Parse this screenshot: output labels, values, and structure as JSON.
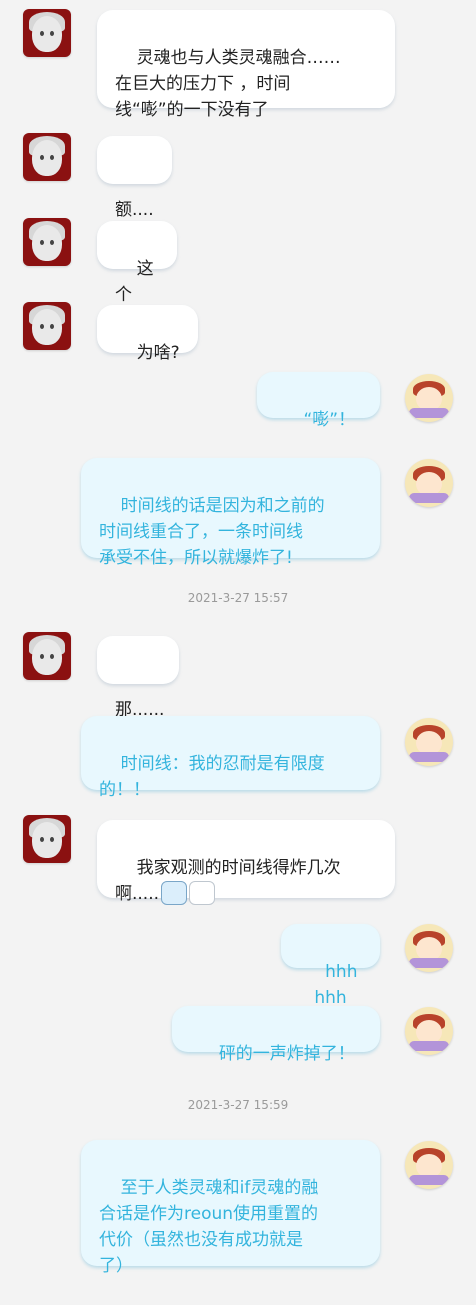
{
  "messages": [
    {
      "side": "left",
      "text": "灵魂也与人类灵魂融合……\n在巨大的压力下 ，时间\n线“嘭”的一下没有了"
    },
    {
      "side": "left",
      "text": "额...."
    },
    {
      "side": "left",
      "text": "这个"
    },
    {
      "side": "left",
      "text": "为啥?"
    },
    {
      "side": "right",
      "text": "“嘭”！"
    },
    {
      "side": "right",
      "text": "时间线的话是因为和之前的\n时间线重合了，一条时间线\n承受不住，所以就爆炸了!"
    },
    {
      "side": "left",
      "text": "那......"
    },
    {
      "side": "right",
      "text": "时间线：我的忍耐是有限度\n的！！"
    },
    {
      "side": "left",
      "text": "我家观测的时间线得炸几次\n啊....."
    },
    {
      "side": "right",
      "text": "hhhhhh"
    },
    {
      "side": "right",
      "text": "砰的一声炸掉了！"
    },
    {
      "side": "right",
      "text": "至于人类灵魂和if灵魂的融\n合话是作为reoun使用重置的\n代价（虽然也没有成功就是\n了）"
    }
  ],
  "timestamps": [
    "2021-3-27 15:57",
    "2021-3-27 15:59"
  ],
  "icons": {
    "emoji_1": "blue-face-sticker-icon",
    "emoji_2": "tv-face-sticker-icon"
  },
  "colors": {
    "background": "#f3f3f3",
    "left_bubble": "#ffffff",
    "right_bubble": "#e8f8fe",
    "right_text": "#33b4dd",
    "timestamp": "#9a9a9a"
  }
}
